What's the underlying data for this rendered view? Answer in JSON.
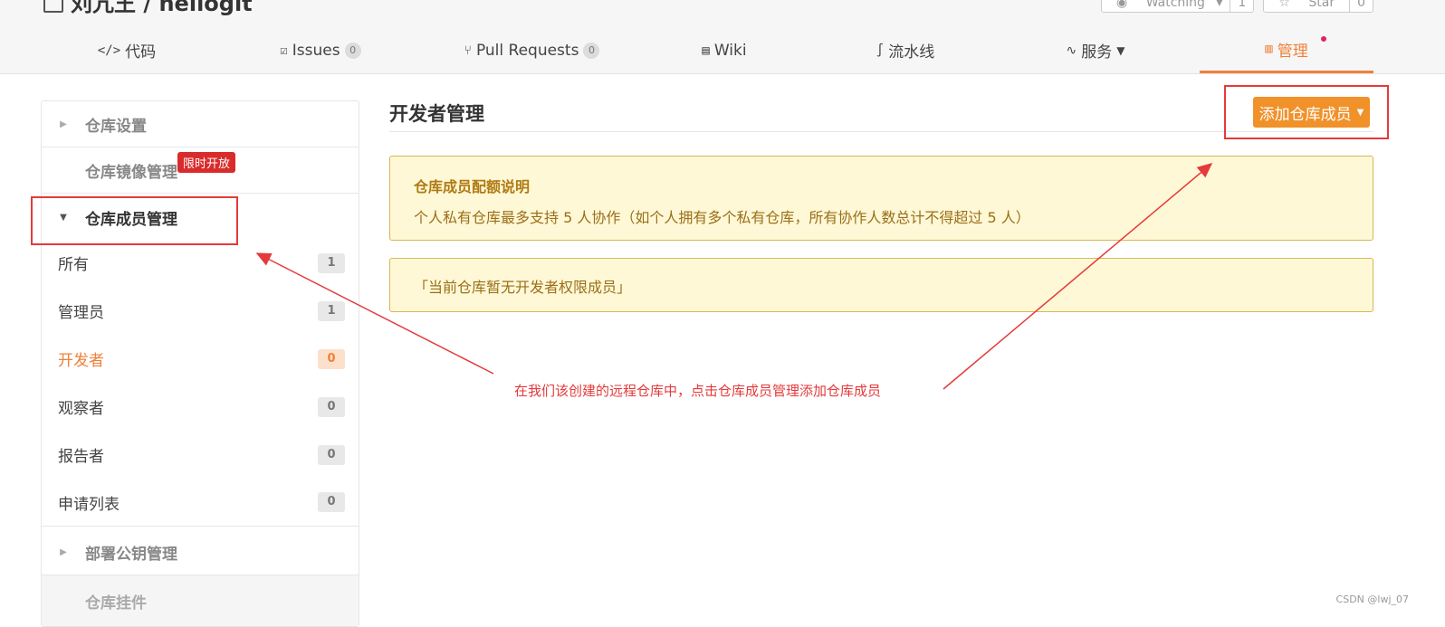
{
  "header": {
    "repo_title": "刘亢王 / hellogit",
    "watch_label": "Watching",
    "watch_count": "1",
    "star_label": "Star",
    "star_count": "0"
  },
  "tabs": [
    {
      "label": "代码",
      "icon": "code-icon"
    },
    {
      "label": "Issues",
      "badge": "0",
      "icon": "issues-icon"
    },
    {
      "label": "Pull Requests",
      "badge": "0",
      "icon": "pull-request-icon"
    },
    {
      "label": "Wiki",
      "icon": "book-icon"
    },
    {
      "label": "流水线",
      "icon": "pipeline-icon"
    },
    {
      "label": "服务",
      "icon": "pulse-icon"
    },
    {
      "label": "管理",
      "icon": "manage-icon"
    }
  ],
  "sidebar": {
    "repo_settings": "仓库设置",
    "mirror_manage": "仓库镜像管理",
    "limited_badge": "限时开放",
    "member_manage": "仓库成员管理",
    "items": [
      {
        "label": "所有",
        "count": "1"
      },
      {
        "label": "管理员",
        "count": "1"
      },
      {
        "label": "开发者",
        "count": "0"
      },
      {
        "label": "观察者",
        "count": "0"
      },
      {
        "label": "报告者",
        "count": "0"
      },
      {
        "label": "申请列表",
        "count": "0"
      }
    ],
    "deploy_keys": "部署公钥管理",
    "repo_hooks": "仓库挂件"
  },
  "main": {
    "title": "开发者管理",
    "add_button": "添加仓库成员",
    "notice_title": "仓库成员配额说明",
    "notice_text": "个人私有仓库最多支持 5 人协作（如个人拥有多个私有仓库，所有协作人数总计不得超过 5 人）",
    "empty_text": "「当前仓库暂无开发者权限成员」"
  },
  "annotation": {
    "text": "在我们该创建的远程仓库中，点击仓库成员管理添加仓库成员",
    "color": "#e43a3a"
  },
  "watermark": "CSDN @lwj_07",
  "colors": {
    "accent": "#f0803a",
    "button": "#f0912a",
    "notice_bg": "#fff8d6"
  }
}
